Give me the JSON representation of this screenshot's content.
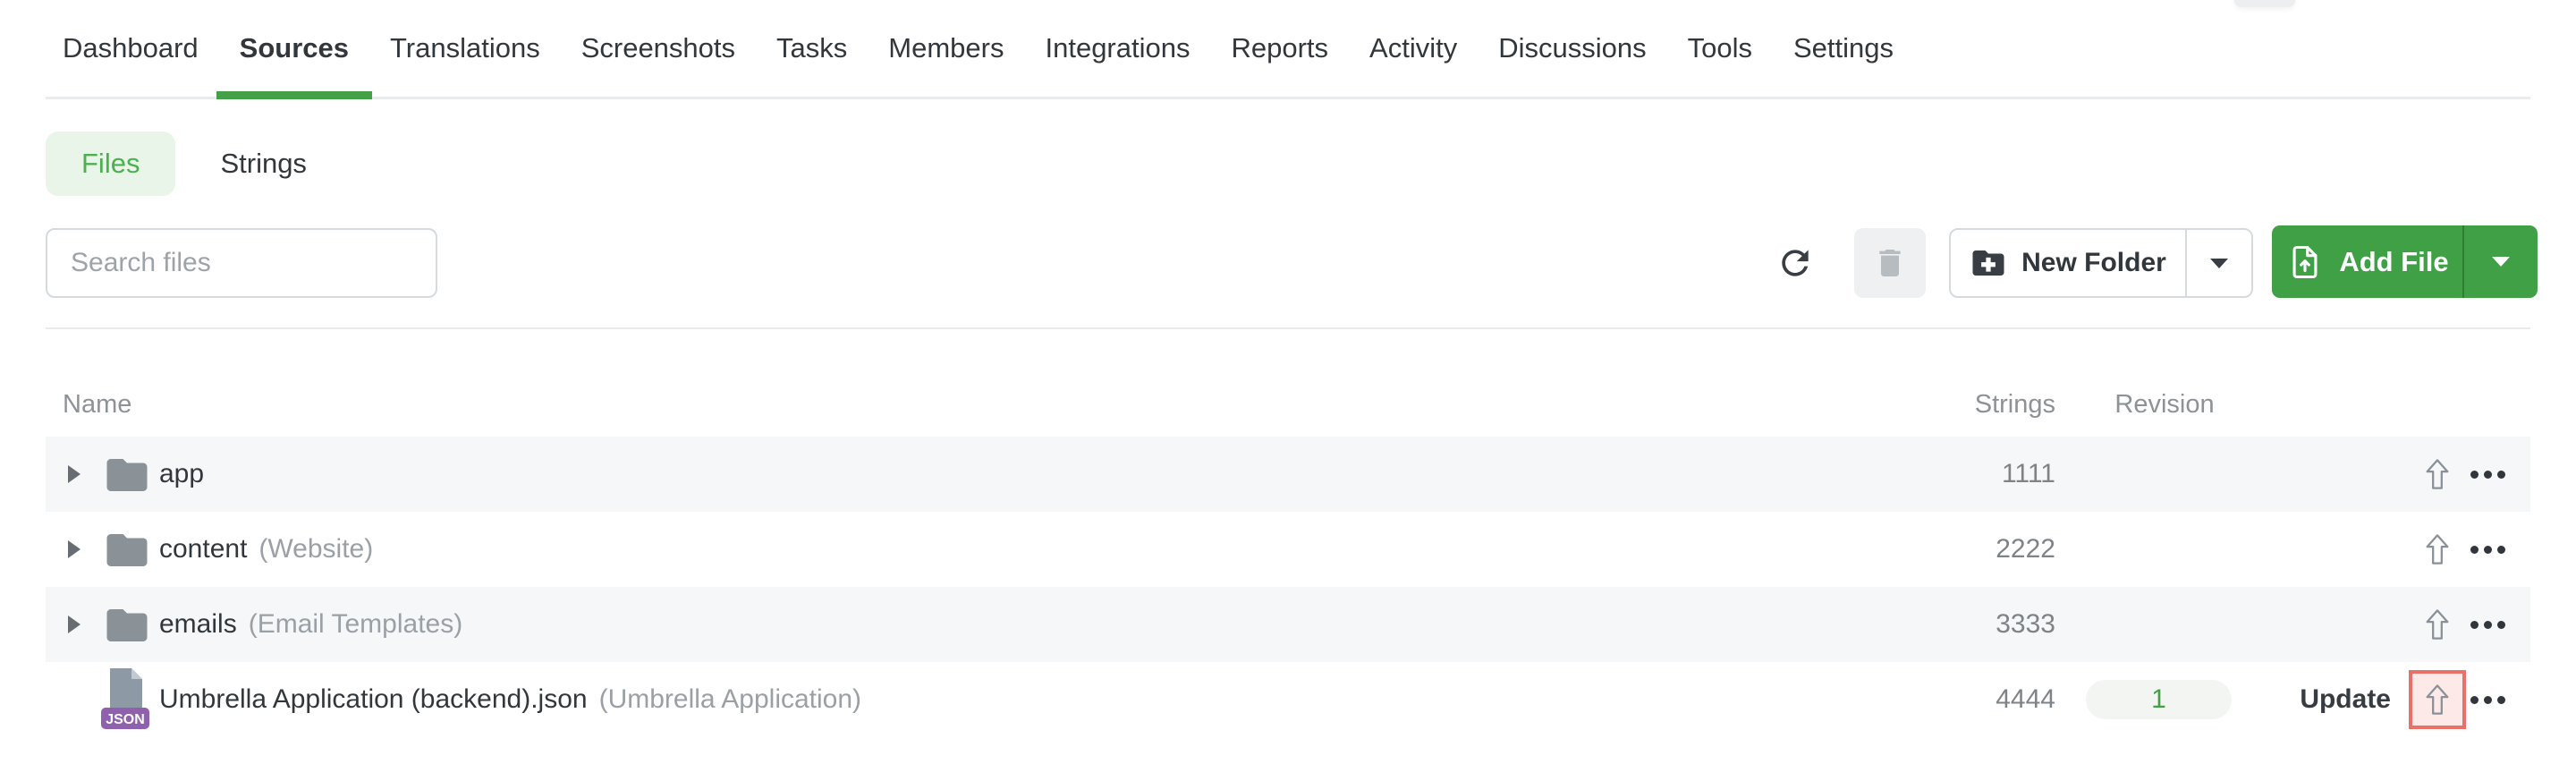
{
  "nav": {
    "items": [
      {
        "label": "Dashboard",
        "active": false
      },
      {
        "label": "Sources",
        "active": true
      },
      {
        "label": "Translations",
        "active": false
      },
      {
        "label": "Screenshots",
        "active": false
      },
      {
        "label": "Tasks",
        "active": false
      },
      {
        "label": "Members",
        "active": false
      },
      {
        "label": "Integrations",
        "active": false
      },
      {
        "label": "Reports",
        "active": false
      },
      {
        "label": "Activity",
        "active": false
      },
      {
        "label": "Discussions",
        "active": false
      },
      {
        "label": "Tools",
        "active": false
      },
      {
        "label": "Settings",
        "active": false
      }
    ]
  },
  "view_tabs": {
    "files_label": "Files",
    "strings_label": "Strings",
    "active": "Files"
  },
  "toolbar": {
    "search_placeholder": "Search files",
    "search_value": "",
    "new_folder_label": "New Folder",
    "add_file_label": "Add File"
  },
  "table": {
    "headers": {
      "name": "Name",
      "strings": "Strings",
      "revision": "Revision"
    },
    "rows": [
      {
        "type": "folder",
        "name": "app",
        "note": "",
        "strings": "1111",
        "revision": "",
        "expandable": true
      },
      {
        "type": "folder",
        "name": "content",
        "note": "(Website)",
        "strings": "2222",
        "revision": "",
        "expandable": true
      },
      {
        "type": "folder",
        "name": "emails",
        "note": "(Email Templates)",
        "strings": "3333",
        "revision": "",
        "expandable": true
      },
      {
        "type": "file",
        "name": "Umbrella Application (backend).json",
        "note": "(Umbrella Application)",
        "strings": "4444",
        "revision": "1",
        "update_label": "Update",
        "file_badge": "JSON",
        "upload_highlighted": true
      }
    ]
  },
  "icons": {
    "refresh": "refresh-icon",
    "trash": "trash-icon",
    "new_folder": "folder-plus-icon",
    "add_file": "file-upload-icon",
    "row_folder": "folder-icon",
    "row_file": "json-file-icon",
    "expand": "expand-caret-icon",
    "upload": "upload-arrow-icon",
    "more": "more-menu-icon"
  },
  "colors": {
    "accent_green": "#43a047",
    "files_tab_text": "#4caf50",
    "files_tab_bg": "#eaf5ea",
    "add_file_button": "#3fa046",
    "highlight_border": "#ea7168",
    "highlight_bg": "#fdeae8",
    "revision_badge_bg": "#f2f5f2",
    "json_badge": "#8f60ad",
    "row_stripe": "#f6f7f8"
  }
}
